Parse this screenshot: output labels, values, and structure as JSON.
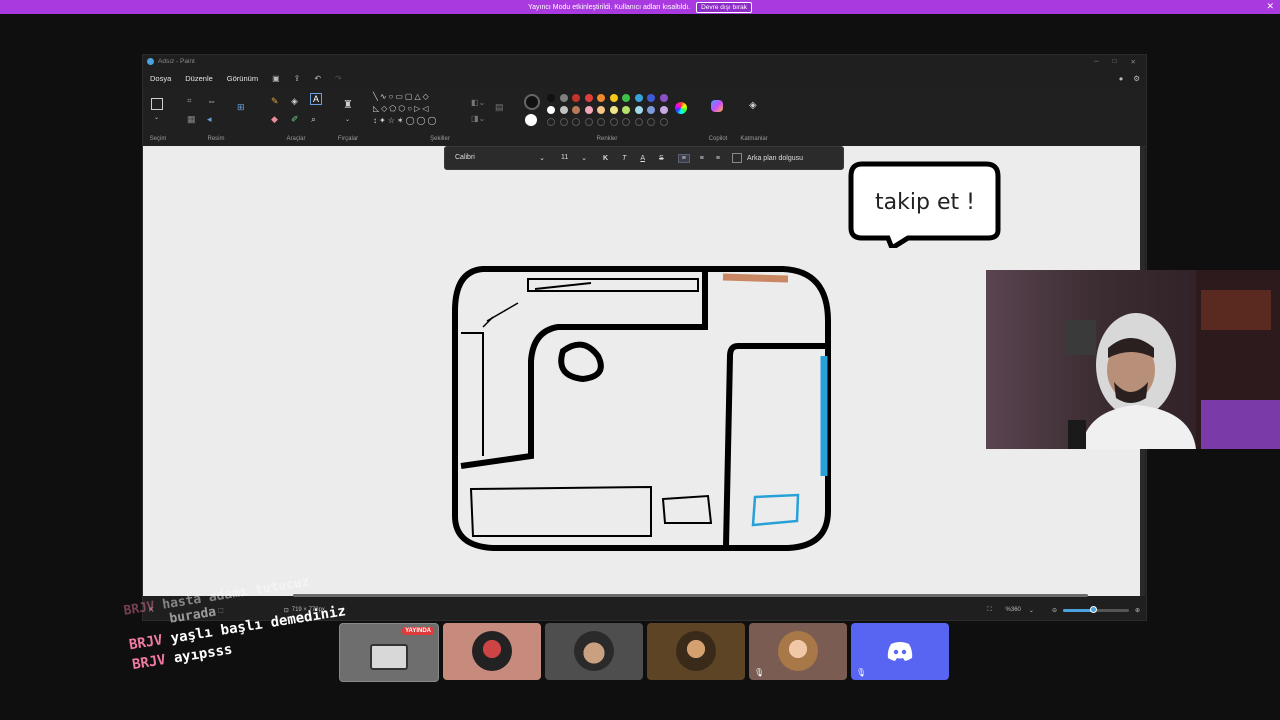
{
  "banner": {
    "text": "Yayıncı Modu etkinleştirildi. Kullanıcı adları kısaltıldı.",
    "button": "Devre dışı bırak",
    "close": "✕"
  },
  "window": {
    "title": "Adsız - Paint"
  },
  "menu": {
    "items": [
      "Dosya",
      "Düzenle",
      "Görünüm"
    ]
  },
  "ribbon": {
    "groups": [
      "Seçim",
      "Resim",
      "Araçlar",
      "Fırçalar",
      "Şekiller",
      "Renkler",
      "Copilot",
      "Katmanlar"
    ]
  },
  "palette": {
    "current": "#111111",
    "row1": [
      "#111111",
      "#7f7f7f",
      "#c3342b",
      "#e0403a",
      "#f08a2b",
      "#f5c918",
      "#3fbf4a",
      "#36a3d9",
      "#3f5ad6",
      "#8b4fc7"
    ],
    "row2": [
      "#ffffff",
      "#c3c3c3",
      "#b97a57",
      "#f3a6b8",
      "#f5c58a",
      "#efe48a",
      "#b5e36a",
      "#9fd9ea",
      "#7f9adb",
      "#c8a8e3"
    ]
  },
  "text_toolbar": {
    "font": "Calibri",
    "size": "11",
    "bold": "K",
    "italic": "T",
    "underline": "A",
    "strike": "S",
    "background_fill": "Arka plan dolgusu"
  },
  "canvas": {
    "speech_bubble": "takip et !"
  },
  "status": {
    "dimensions": "719 × 778px",
    "zoom": "%360"
  },
  "tiles": [
    {
      "badge": "YAYINDA"
    },
    {},
    {},
    {},
    {},
    {}
  ],
  "chat": [
    {
      "user": "BRJV",
      "message": "hasta adamı tutucuz"
    },
    {
      "user": "",
      "message": "burada"
    },
    {
      "user": "BRJV",
      "message": "yaşlı başlı demediniz"
    },
    {
      "user": "BRJV",
      "message": "ayıpsss"
    }
  ]
}
